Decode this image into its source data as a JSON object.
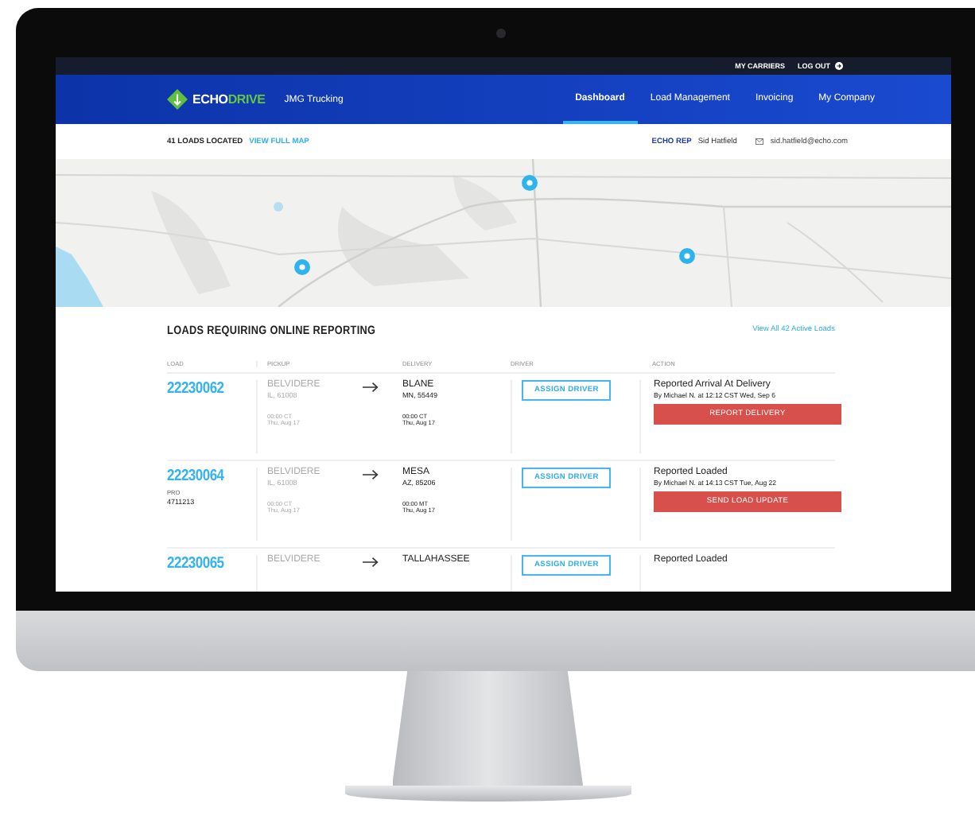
{
  "top_bar": {
    "links": [
      "MY CARRIERS",
      "LOG OUT"
    ]
  },
  "header": {
    "brand": [
      "ECHO",
      "DRIVE"
    ],
    "company": "JMG Trucking",
    "nav": [
      {
        "label": "Dashboard",
        "selected": true
      },
      {
        "label": "Load Management",
        "selected": false
      },
      {
        "label": "Invoicing",
        "selected": false
      },
      {
        "label": "My Company",
        "selected": false
      }
    ]
  },
  "info_bar": {
    "count": "41 LOADS LOCATED",
    "map_link": "VIEW FULL MAP",
    "rep_label": "ECHO REP",
    "rep_name": "Sid Hatfield",
    "rep_email": "sid.hatfield@echo.com"
  },
  "loads": {
    "title": "LOADS REQUIRING ONLINE REPORTING",
    "view_all": "View All 42 Active Loads",
    "columns": [
      "LOAD",
      "PICKUP",
      "DELIVERY",
      "DRIVER",
      "ACTION"
    ],
    "rows": [
      {
        "load": "22230062",
        "pickup": [
          "BELVIDERE",
          "IL, 61008",
          "00:00 CT",
          "Thu, Aug 17"
        ],
        "delivery": [
          "BLANE",
          "MN, 55449",
          "00:00 CT",
          "Thu, Aug 17"
        ],
        "driver_button": "ASSIGN DRIVER",
        "status": "Reported Arrival At Delivery",
        "status_by": "By Michael N. at 12:12 CST Wed, Sep 6",
        "action": "REPORT DELIVERY"
      },
      {
        "load": "22230064",
        "pro_label": "PRO",
        "pro": "4711213",
        "pickup": [
          "BELVIDERE",
          "IL, 61008",
          "00:00 CT",
          "Thu, Aug 17"
        ],
        "delivery": [
          "MESA",
          "AZ, 85206",
          "00:00 MT",
          "Thu, Aug 17"
        ],
        "driver_button": "ASSIGN DRIVER",
        "status": "Reported Loaded",
        "status_by": "By Michael N. at 14:13 CST Tue, Aug 22",
        "action": "SEND LOAD UPDATE"
      },
      {
        "load": "22230065",
        "pickup": [
          "BELVIDERE"
        ],
        "delivery": [
          "TALLAHASSEE"
        ],
        "driver_button": "ASSIGN DRIVER",
        "status": "Reported Loaded"
      }
    ]
  }
}
